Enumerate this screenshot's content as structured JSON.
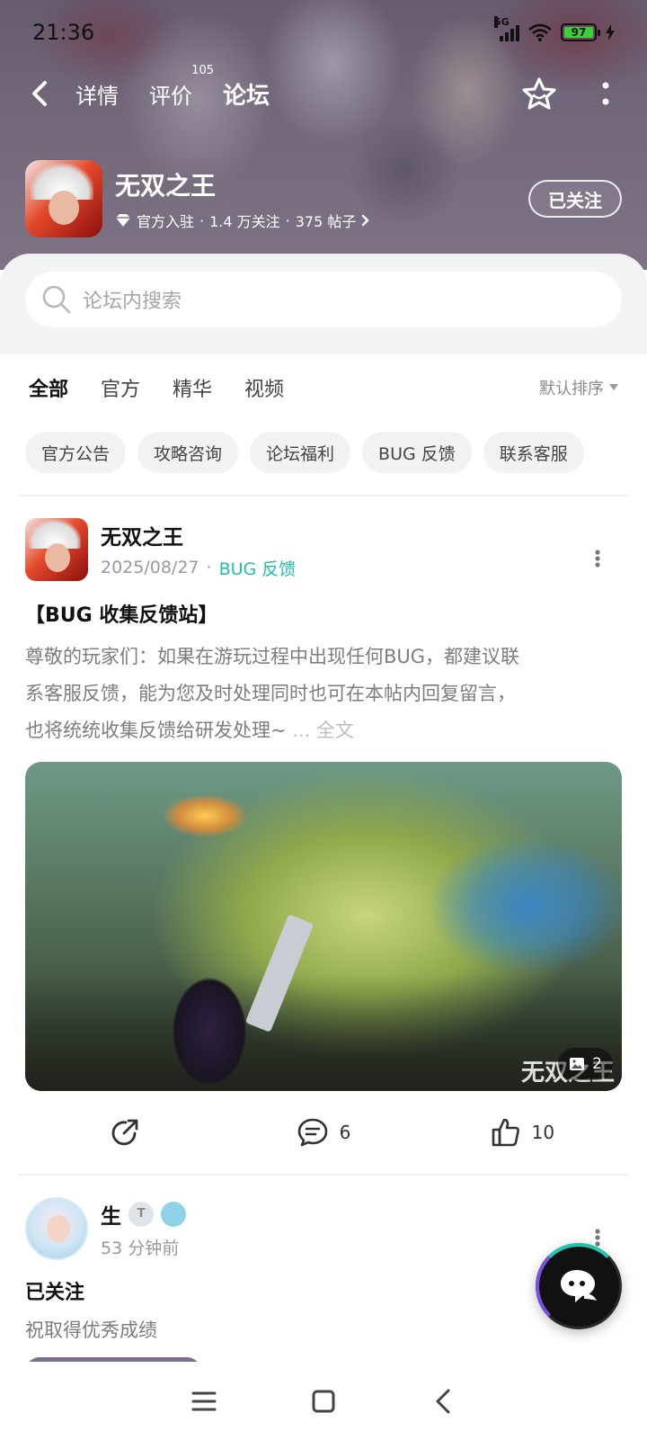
{
  "status_bar": {
    "time": "21:36",
    "network": "5G",
    "battery": "97",
    "icons": [
      "signal-icon",
      "wifi-icon",
      "battery-icon",
      "charging-icon"
    ]
  },
  "nav": {
    "tabs": [
      {
        "label": "详情",
        "active": false
      },
      {
        "label": "评价",
        "active": false,
        "badge": "105"
      },
      {
        "label": "论坛",
        "active": true
      }
    ],
    "accent_color": "#1ec8b0"
  },
  "game": {
    "name": "无双之王",
    "official": "官方入驻",
    "followers": "1.4 万关注",
    "posts": "375 帖子",
    "follow_label": "已关注"
  },
  "search": {
    "placeholder": "论坛内搜索"
  },
  "filters": {
    "tabs": [
      "全部",
      "官方",
      "精华",
      "视频"
    ],
    "active": "全部",
    "sort_label": "默认排序"
  },
  "chips": [
    "官方公告",
    "攻略咨询",
    "论坛福利",
    "BUG 反馈",
    "联系客服"
  ],
  "post1": {
    "author": "无双之王",
    "date": "2025/08/27",
    "tag": "BUG 反馈",
    "title": "【BUG 收集反馈站】",
    "body_lines": [
      "尊敬的玩家们：如果在游玩过程中出现任何BUG，都建议联",
      "系客服反馈，能为您及时处理同时也可在本帖内回复留言，",
      "也将统统收集反馈给研发处理~"
    ],
    "ellipsis": "...",
    "fulltext_label": "全文",
    "image_count": "2",
    "watermark": "无双之王",
    "comments": "6",
    "likes": "10"
  },
  "post2": {
    "author": "生",
    "time": "53 分钟前",
    "title": "已关注",
    "body": "祝取得优秀成绩"
  }
}
